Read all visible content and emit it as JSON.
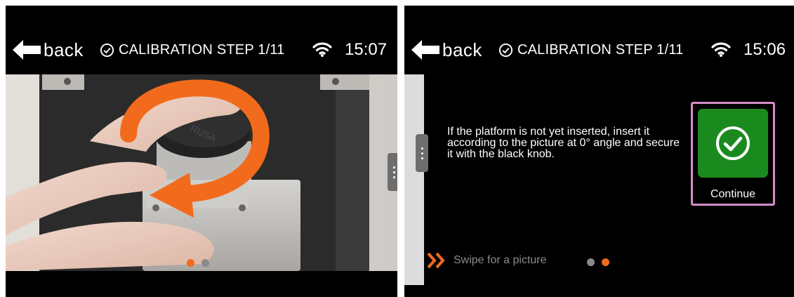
{
  "screens": [
    {
      "back_label": "back",
      "step_title": "CALIBRATION STEP 1/11",
      "time": "15:07"
    },
    {
      "back_label": "back",
      "step_title": "CALIBRATION STEP 1/11",
      "time": "15:06",
      "instruction": "If the platform is not yet inserted, insert it according to the picture at 0° angle and secure it with the black knob.",
      "continue_label": "Continue",
      "swipe_hint": "Swipe for a picture"
    }
  ],
  "colors": {
    "accent_orange": "#f26b1d",
    "continue_green": "#1a8a1e",
    "highlight_pink": "#d48cc8",
    "dot_inactive": "#8a8a8a"
  },
  "pager": {
    "left_active_index": 0,
    "right_active_index": 1,
    "count": 2
  }
}
